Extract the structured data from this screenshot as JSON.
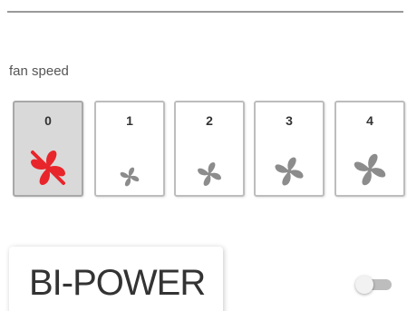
{
  "fan_speed": {
    "label": "fan speed",
    "selected": "0",
    "options": [
      {
        "value": "0",
        "icon": "fan-off-icon",
        "color": "#e8252b"
      },
      {
        "value": "1",
        "icon": "fan-icon",
        "color": "#8c8c8c"
      },
      {
        "value": "2",
        "icon": "fan-icon",
        "color": "#8c8c8c"
      },
      {
        "value": "3",
        "icon": "fan-icon",
        "color": "#8c8c8c"
      },
      {
        "value": "4",
        "icon": "fan-icon",
        "color": "#8c8c8c"
      }
    ]
  },
  "bi_power": {
    "label": "BI-POWER",
    "toggle_on": false
  },
  "colors": {
    "selected_background": "#d9d9d9",
    "active_fan": "#e8252b",
    "inactive_fan": "#8c8c8c"
  }
}
